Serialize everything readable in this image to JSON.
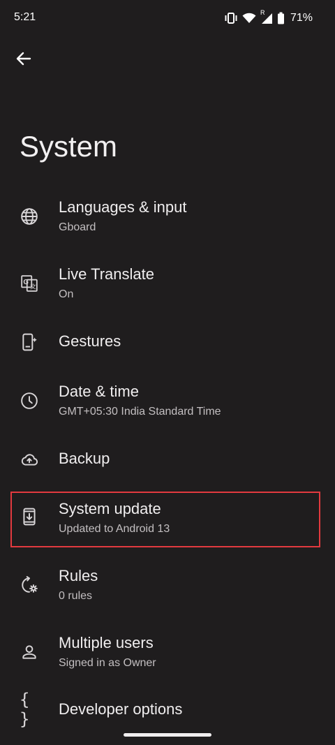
{
  "status_bar": {
    "time": "5:21",
    "battery_percent": "71%",
    "network_label": "R"
  },
  "header": {
    "title": "System"
  },
  "settings": [
    {
      "title": "Languages & input",
      "summary": "Gboard",
      "icon": "globe-icon"
    },
    {
      "title": "Live Translate",
      "summary": "On",
      "icon": "translate-icon"
    },
    {
      "title": "Gestures",
      "summary": "",
      "icon": "gestures-phone-icon"
    },
    {
      "title": "Date & time",
      "summary": "GMT+05:30 India Standard Time",
      "icon": "clock-icon"
    },
    {
      "title": "Backup",
      "summary": "",
      "icon": "cloud-upload-icon"
    },
    {
      "title": "System update",
      "summary": "Updated to Android 13",
      "icon": "system-update-icon"
    },
    {
      "title": "Rules",
      "summary": "0 rules",
      "icon": "rules-icon"
    },
    {
      "title": "Multiple users",
      "summary": "Signed in as Owner",
      "icon": "person-icon"
    },
    {
      "title": "Developer options",
      "summary": "",
      "icon": "braces-icon"
    }
  ],
  "colors": {
    "background": "#1f1d1e",
    "highlight": "#e23a3f"
  }
}
